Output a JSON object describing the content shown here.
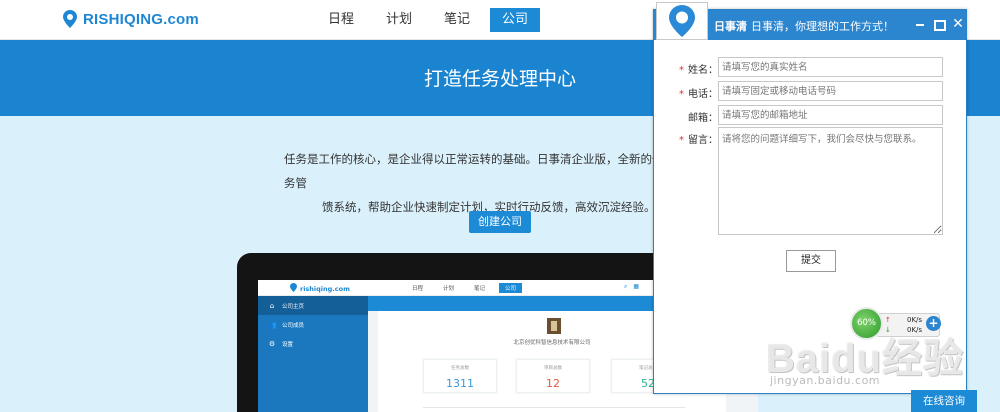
{
  "site": {
    "logo_text": "RISHIQING.com",
    "nav": [
      {
        "label": "日程",
        "active": false
      },
      {
        "label": "计划",
        "active": false
      },
      {
        "label": "笔记",
        "active": false
      },
      {
        "label": "公司",
        "active": true
      }
    ]
  },
  "hero": {
    "title": "打造任务处理中心"
  },
  "main": {
    "desc_line1": "任务是工作的核心，是企业得以正常运转的基础。日事清企业版，全新的任务管",
    "desc_line2": "馈系统，帮助企业快速制定计划，实时行动反馈，高效沉淀经验。",
    "create_button": "创建公司"
  },
  "mockup": {
    "logo": "rishiqing.com",
    "nav": [
      "日程",
      "计划",
      "笔记",
      "公司"
    ],
    "sidebar": [
      "公司主页",
      "公司成员",
      "设置"
    ],
    "company_name": "北京创优科智信息技术有限公司",
    "stats": [
      {
        "label": "任务总数",
        "value": "1311"
      },
      {
        "label": "项目总数",
        "value": "12"
      },
      {
        "label": "笔记总数",
        "value": "52"
      }
    ]
  },
  "popup": {
    "brand": "日事清",
    "slogan": "日事清，你理想的工作方式！",
    "fields": [
      {
        "label": "姓名：",
        "required": true,
        "placeholder": "请填写您的真实姓名"
      },
      {
        "label": "电话：",
        "required": true,
        "placeholder": "请填写固定或移动电话号码"
      },
      {
        "label": "邮箱：",
        "required": false,
        "placeholder": "请填写您的邮箱地址"
      },
      {
        "label": "留言：",
        "required": true,
        "placeholder": "请将您的问题详细写下，我们会尽快与您联系。"
      }
    ],
    "submit": "提交",
    "required_mark": "*"
  },
  "speed_widget": {
    "percent": "60%",
    "up": "0K/s",
    "down": "0K/s"
  },
  "watermark": {
    "brand": "Baidu经验",
    "url": "jingyan.baidu.com"
  },
  "consult_button": "在线咨询",
  "colors": {
    "primary": "#1d8ad6",
    "hero": "#1a84d0",
    "page_bg": "#daf0fb",
    "popup_head": "#2c85cf"
  }
}
